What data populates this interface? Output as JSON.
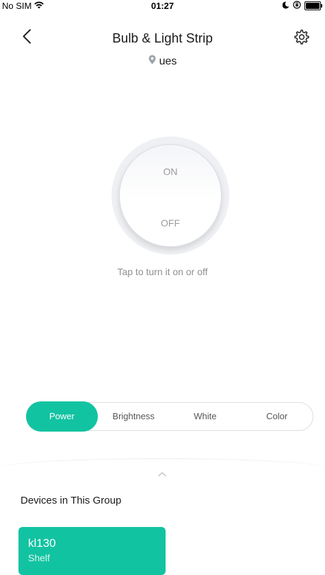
{
  "status_bar": {
    "carrier": "No SIM",
    "time": "01:27",
    "icons": [
      "wifi-icon",
      "moon-icon",
      "orientation-lock-icon",
      "battery-icon"
    ]
  },
  "header": {
    "title": "Bulb & Light Strip",
    "location": "ues",
    "back_icon": "chevron-left-icon",
    "settings_icon": "gear-icon",
    "location_icon": "location-pin-icon"
  },
  "toggle": {
    "on_label": "ON",
    "off_label": "OFF",
    "hint": "Tap to turn it on or off"
  },
  "tabs": [
    {
      "label": "Power",
      "active": true
    },
    {
      "label": "Brightness",
      "active": false
    },
    {
      "label": "White",
      "active": false
    },
    {
      "label": "Color",
      "active": false
    }
  ],
  "devices_section": {
    "title": "Devices in This Group",
    "devices": [
      {
        "name": "kl130",
        "room": "Shelf"
      }
    ]
  },
  "colors": {
    "accent": "#12c3a2",
    "text": "#1a1a1a",
    "muted": "#9a9a9a",
    "border": "#dadde2"
  }
}
